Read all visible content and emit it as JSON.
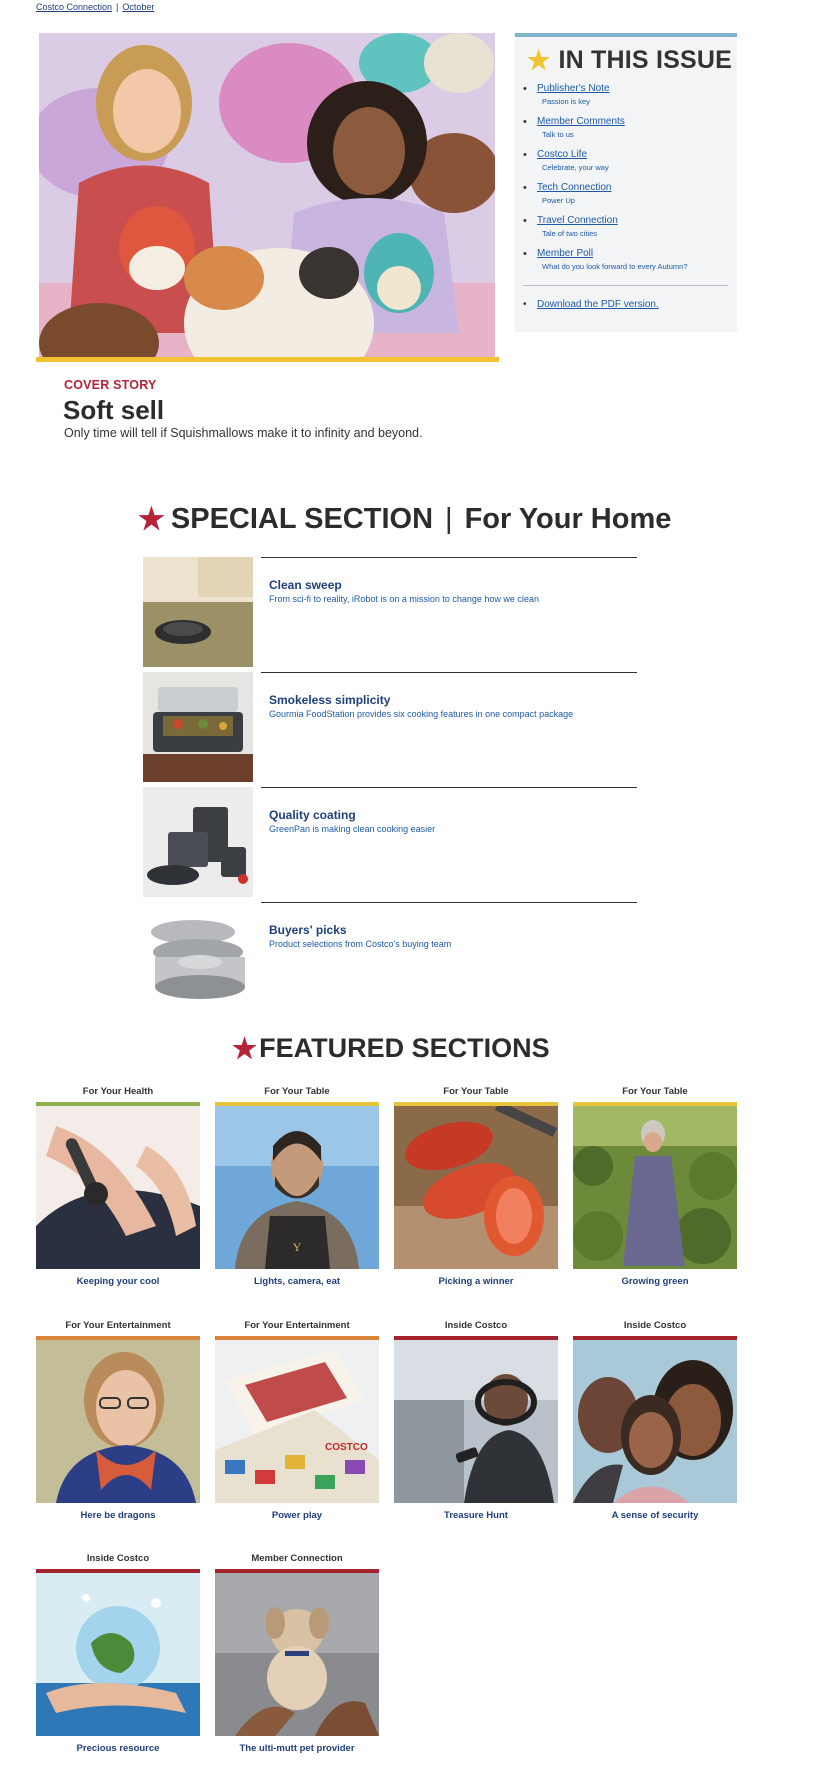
{
  "breadcrumb": {
    "home": "Costco Connection",
    "current": "October"
  },
  "hero": {
    "bar_color": "#f1c232"
  },
  "in_this_issue": {
    "title": "IN THIS ISSUE",
    "items": [
      {
        "title": "Publisher's Note",
        "subtitle": "Passion is key"
      },
      {
        "title": "Member Comments",
        "subtitle": "Talk to us"
      },
      {
        "title": "Costco Life",
        "subtitle": "Celebrate, your way"
      },
      {
        "title": "Tech Connection",
        "subtitle": "Power Up"
      },
      {
        "title": "Travel Connection",
        "subtitle": "Tale of two cities"
      },
      {
        "title": "Member Poll",
        "subtitle": "What do you look forward to every Autumn?"
      }
    ],
    "pdf_link": "Download the PDF version."
  },
  "cover_story": {
    "kicker": "COVER STORY",
    "title": "Soft sell",
    "dek": "Only time will tell if Squishmallows make it to infinity and beyond."
  },
  "special_section": {
    "label": "SPECIAL SECTION",
    "separator": "|",
    "subtitle": "For Your Home",
    "items": [
      {
        "title": "Clean sweep",
        "desc": "From sci-fi to reality, iRobot is on a mission to change how we clean"
      },
      {
        "title": "Smokeless simplicity",
        "desc": "Gourmia FoodStation provides six cooking features in one compact package"
      },
      {
        "title": "Quality coating",
        "desc": "GreenPan is making clean cooking easier"
      },
      {
        "title": "Buyers' picks",
        "desc": "Product selections from Costco's buying team"
      }
    ]
  },
  "featured": {
    "title": "FEATURED SECTIONS",
    "colors": {
      "health": "#8cb04e",
      "table": "#e8c43a",
      "entertainment": "#d9843a",
      "inside": "#a5232f",
      "member": "#a5232f"
    },
    "cards": [
      {
        "category": "For Your Health",
        "caption": "Keeping your cool",
        "color": "#8cb04e"
      },
      {
        "category": "For Your Table",
        "caption": "Lights, camera, eat",
        "color": "#e8c43a"
      },
      {
        "category": "For Your Table",
        "caption": "Picking a winner",
        "color": "#e8c43a"
      },
      {
        "category": "For Your Table",
        "caption": "Growing green",
        "color": "#e8c43a"
      },
      {
        "category": "For Your Entertainment",
        "caption": "Here be dragons",
        "color": "#d9843a"
      },
      {
        "category": "For Your Entertainment",
        "caption": "Power play",
        "color": "#d9843a"
      },
      {
        "category": "Inside Costco",
        "caption": "Treasure Hunt",
        "color": "#a5232f"
      },
      {
        "category": "Inside Costco",
        "caption": "A sense of security",
        "color": "#a5232f"
      },
      {
        "category": "Inside Costco",
        "caption": "Precious resource",
        "color": "#a5232f"
      },
      {
        "category": "Member Connection",
        "caption": "The ulti-mutt pet provider",
        "color": "#a5232f"
      }
    ]
  }
}
